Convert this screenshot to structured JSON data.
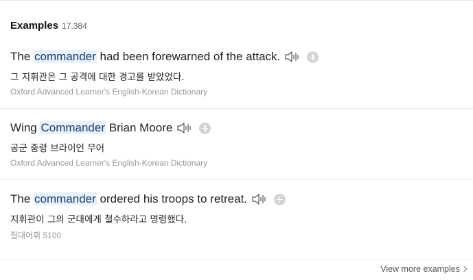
{
  "header": {
    "title": "Examples",
    "count": "17,384"
  },
  "examples": [
    {
      "before": "The ",
      "highlight": "commander",
      "after": " had been forewarned of the attack.",
      "translation": "그 지휘관은 그 공격에 대한 경고를 받았었다.",
      "source": "Oxford Advanced Learner's English-Korean Dictionary"
    },
    {
      "before": "Wing ",
      "highlight": "Commander",
      "after": " Brian Moore",
      "translation": "공군 중령 브라이언 무어",
      "source": "Oxford Advanced Learner's English-Korean Dictionary"
    },
    {
      "before": "The ",
      "highlight": "commander",
      "after": " ordered his troops to retreat.",
      "translation": "지휘관이 그의 군대에게 철수하라고 명령했다.",
      "source": "절대어휘 5100"
    }
  ],
  "footer": {
    "more_label": "View more examples"
  },
  "icons": {
    "speaker": "speaker-icon",
    "add": "add-icon",
    "more": "chevron-right-icon"
  },
  "colors": {
    "highlight_bg": "#e6f1fb",
    "source_text": "#999999",
    "add_icon": "#d4d4d4"
  }
}
